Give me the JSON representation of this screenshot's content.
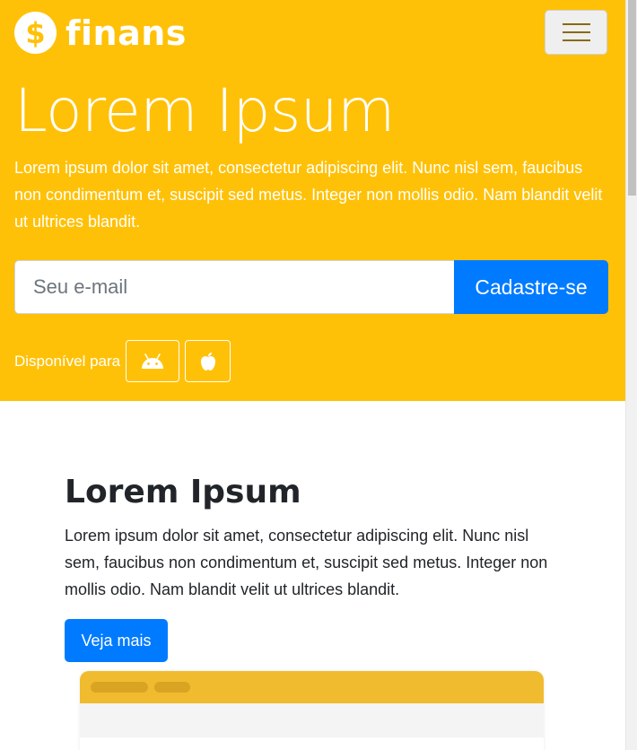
{
  "brand": {
    "logo_symbol": "$",
    "name": "finans"
  },
  "nav": {
    "toggler_icon": "hamburger-menu-icon"
  },
  "hero": {
    "title": "Lorem Ipsum",
    "text": "Lorem ipsum dolor sit amet, consectetur adipiscing elit. Nunc nisl sem, faucibus non condimentum et, suscipit sed metus. Integer non mollis odio. Nam blandit velit ut ultrices blandit.",
    "email_placeholder": "Seu e-mail",
    "signup_label": "Cadastre-se",
    "available_label": "Disponível para",
    "stores": [
      "android-icon",
      "apple-icon"
    ]
  },
  "section": {
    "title": "Lorem Ipsum",
    "text": "Lorem ipsum dolor sit amet, consectetur adipiscing elit. Nunc nisl sem, faucibus non condimentum et, suscipit sed metus. Integer non mollis odio. Nam blandit velit ut ultrices blandit.",
    "button_label": "Veja mais"
  },
  "colors": {
    "primary_yellow": "#ffc107",
    "primary_blue": "#007bff",
    "mockup_yellow": "#f0bb2e",
    "text_dark": "#212529"
  }
}
